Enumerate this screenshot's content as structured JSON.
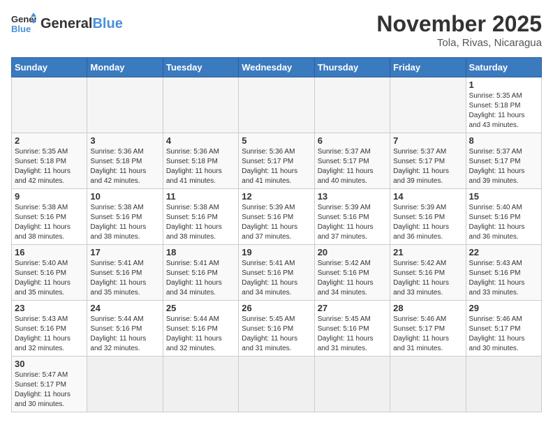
{
  "header": {
    "logo_general": "General",
    "logo_blue": "Blue",
    "month_title": "November 2025",
    "location": "Tola, Rivas, Nicaragua"
  },
  "weekdays": [
    "Sunday",
    "Monday",
    "Tuesday",
    "Wednesday",
    "Thursday",
    "Friday",
    "Saturday"
  ],
  "weeks": [
    [
      {
        "day": "",
        "info": ""
      },
      {
        "day": "",
        "info": ""
      },
      {
        "day": "",
        "info": ""
      },
      {
        "day": "",
        "info": ""
      },
      {
        "day": "",
        "info": ""
      },
      {
        "day": "",
        "info": ""
      },
      {
        "day": "1",
        "info": "Sunrise: 5:35 AM\nSunset: 5:18 PM\nDaylight: 11 hours\nand 43 minutes."
      }
    ],
    [
      {
        "day": "2",
        "info": "Sunrise: 5:35 AM\nSunset: 5:18 PM\nDaylight: 11 hours\nand 42 minutes."
      },
      {
        "day": "3",
        "info": "Sunrise: 5:36 AM\nSunset: 5:18 PM\nDaylight: 11 hours\nand 42 minutes."
      },
      {
        "day": "4",
        "info": "Sunrise: 5:36 AM\nSunset: 5:18 PM\nDaylight: 11 hours\nand 41 minutes."
      },
      {
        "day": "5",
        "info": "Sunrise: 5:36 AM\nSunset: 5:17 PM\nDaylight: 11 hours\nand 41 minutes."
      },
      {
        "day": "6",
        "info": "Sunrise: 5:37 AM\nSunset: 5:17 PM\nDaylight: 11 hours\nand 40 minutes."
      },
      {
        "day": "7",
        "info": "Sunrise: 5:37 AM\nSunset: 5:17 PM\nDaylight: 11 hours\nand 39 minutes."
      },
      {
        "day": "8",
        "info": "Sunrise: 5:37 AM\nSunset: 5:17 PM\nDaylight: 11 hours\nand 39 minutes."
      }
    ],
    [
      {
        "day": "9",
        "info": "Sunrise: 5:38 AM\nSunset: 5:16 PM\nDaylight: 11 hours\nand 38 minutes."
      },
      {
        "day": "10",
        "info": "Sunrise: 5:38 AM\nSunset: 5:16 PM\nDaylight: 11 hours\nand 38 minutes."
      },
      {
        "day": "11",
        "info": "Sunrise: 5:38 AM\nSunset: 5:16 PM\nDaylight: 11 hours\nand 38 minutes."
      },
      {
        "day": "12",
        "info": "Sunrise: 5:39 AM\nSunset: 5:16 PM\nDaylight: 11 hours\nand 37 minutes."
      },
      {
        "day": "13",
        "info": "Sunrise: 5:39 AM\nSunset: 5:16 PM\nDaylight: 11 hours\nand 37 minutes."
      },
      {
        "day": "14",
        "info": "Sunrise: 5:39 AM\nSunset: 5:16 PM\nDaylight: 11 hours\nand 36 minutes."
      },
      {
        "day": "15",
        "info": "Sunrise: 5:40 AM\nSunset: 5:16 PM\nDaylight: 11 hours\nand 36 minutes."
      }
    ],
    [
      {
        "day": "16",
        "info": "Sunrise: 5:40 AM\nSunset: 5:16 PM\nDaylight: 11 hours\nand 35 minutes."
      },
      {
        "day": "17",
        "info": "Sunrise: 5:41 AM\nSunset: 5:16 PM\nDaylight: 11 hours\nand 35 minutes."
      },
      {
        "day": "18",
        "info": "Sunrise: 5:41 AM\nSunset: 5:16 PM\nDaylight: 11 hours\nand 34 minutes."
      },
      {
        "day": "19",
        "info": "Sunrise: 5:41 AM\nSunset: 5:16 PM\nDaylight: 11 hours\nand 34 minutes."
      },
      {
        "day": "20",
        "info": "Sunrise: 5:42 AM\nSunset: 5:16 PM\nDaylight: 11 hours\nand 34 minutes."
      },
      {
        "day": "21",
        "info": "Sunrise: 5:42 AM\nSunset: 5:16 PM\nDaylight: 11 hours\nand 33 minutes."
      },
      {
        "day": "22",
        "info": "Sunrise: 5:43 AM\nSunset: 5:16 PM\nDaylight: 11 hours\nand 33 minutes."
      }
    ],
    [
      {
        "day": "23",
        "info": "Sunrise: 5:43 AM\nSunset: 5:16 PM\nDaylight: 11 hours\nand 32 minutes."
      },
      {
        "day": "24",
        "info": "Sunrise: 5:44 AM\nSunset: 5:16 PM\nDaylight: 11 hours\nand 32 minutes."
      },
      {
        "day": "25",
        "info": "Sunrise: 5:44 AM\nSunset: 5:16 PM\nDaylight: 11 hours\nand 32 minutes."
      },
      {
        "day": "26",
        "info": "Sunrise: 5:45 AM\nSunset: 5:16 PM\nDaylight: 11 hours\nand 31 minutes."
      },
      {
        "day": "27",
        "info": "Sunrise: 5:45 AM\nSunset: 5:16 PM\nDaylight: 11 hours\nand 31 minutes."
      },
      {
        "day": "28",
        "info": "Sunrise: 5:46 AM\nSunset: 5:17 PM\nDaylight: 11 hours\nand 31 minutes."
      },
      {
        "day": "29",
        "info": "Sunrise: 5:46 AM\nSunset: 5:17 PM\nDaylight: 11 hours\nand 30 minutes."
      }
    ],
    [
      {
        "day": "30",
        "info": "Sunrise: 5:47 AM\nSunset: 5:17 PM\nDaylight: 11 hours\nand 30 minutes."
      },
      {
        "day": "",
        "info": ""
      },
      {
        "day": "",
        "info": ""
      },
      {
        "day": "",
        "info": ""
      },
      {
        "day": "",
        "info": ""
      },
      {
        "day": "",
        "info": ""
      },
      {
        "day": "",
        "info": ""
      }
    ]
  ]
}
